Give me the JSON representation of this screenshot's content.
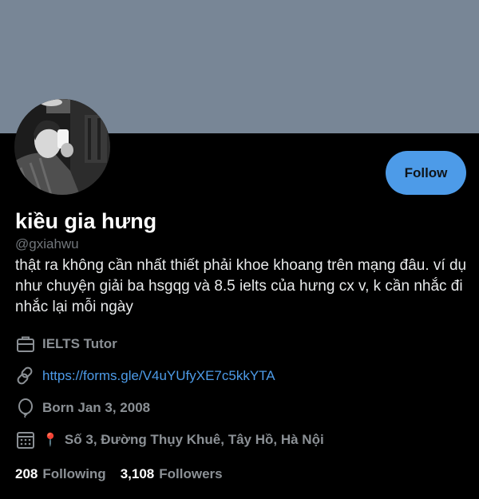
{
  "profile": {
    "display_name": "kiều gia hưng",
    "handle": "@gxiahwu",
    "bio": "thật ra không cần nhất thiết phải khoe khoang trên mạng đâu. ví dụ như chuyện giải ba hsgqg và 8.5 ielts của hưng cx v, k cần nhắc đi nhắc lại mỗi ngày",
    "follow_label": "Follow",
    "job": "IELTS Tutor",
    "link": "https://forms.gle/V4uYUfyXE7c5kkYTA",
    "birthday": "Born Jan 3, 2008",
    "pin_glyph": "📍",
    "location": "Số 3, Đường Thụy Khuê, Tây Hồ, Hà Nội"
  },
  "stats": {
    "following_count": "208",
    "following_label": "Following",
    "followers_count": "3,108",
    "followers_label": "Followers"
  },
  "icons": {
    "job": "briefcase-icon",
    "link": "link-icon",
    "birthday": "balloon-icon",
    "joined": "calendar-icon"
  },
  "colors": {
    "banner": "#788696",
    "background": "#000000",
    "accent": "#4d9be8",
    "secondary_text": "#8b9095"
  }
}
